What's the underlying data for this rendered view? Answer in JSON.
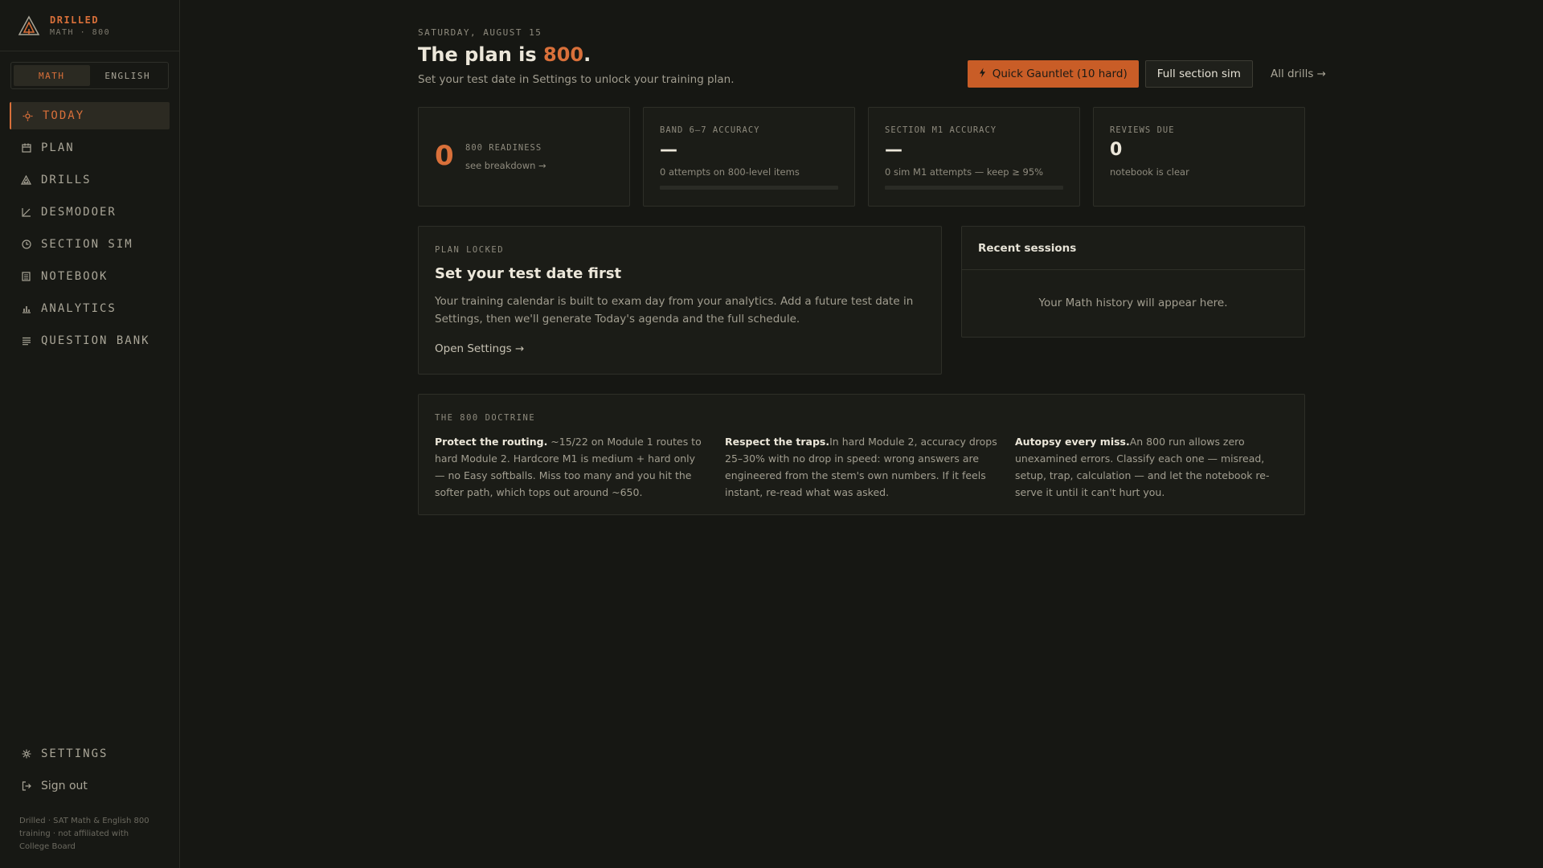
{
  "brand": {
    "name": "DRILLED",
    "sub": "MATH · 800"
  },
  "subject_toggle": {
    "options": [
      "MATH",
      "ENGLISH"
    ],
    "active": "MATH"
  },
  "nav": {
    "items": [
      {
        "label": "TODAY",
        "icon": "sun-icon"
      },
      {
        "label": "PLAN",
        "icon": "calendar-icon"
      },
      {
        "label": "DRILLS",
        "icon": "triangle-icon"
      },
      {
        "label": "DESMODOER",
        "icon": "graph-icon"
      },
      {
        "label": "SECTION SIM",
        "icon": "clock-icon"
      },
      {
        "label": "NOTEBOOK",
        "icon": "notebook-icon"
      },
      {
        "label": "ANALYTICS",
        "icon": "bar-chart-icon"
      },
      {
        "label": "QUESTION BANK",
        "icon": "list-icon"
      }
    ],
    "active": "TODAY",
    "settings": "SETTINGS",
    "signout": "Sign out"
  },
  "footer": "Drilled · SAT Math & English 800 training · not affiliated with College Board",
  "header": {
    "date": "SATURDAY, AUGUST 15",
    "title_prefix": "The plan is ",
    "title_accent": "800",
    "title_suffix": ".",
    "subtitle": "Set your test date in Settings to unlock your training plan."
  },
  "actions": {
    "quick_gauntlet": "Quick Gauntlet (10 hard)",
    "full_sim": "Full section sim",
    "all_drills": "All drills →"
  },
  "stats": {
    "readiness": {
      "value": "0",
      "label": "800 READINESS",
      "link": "see breakdown →"
    },
    "band": {
      "label": "BAND 6–7 ACCURACY",
      "value": "—",
      "sub": "0 attempts on 800-level items",
      "progress": 0
    },
    "m1": {
      "label": "SECTION M1 ACCURACY",
      "value": "—",
      "sub": "0 sim M1 attempts — keep ≥ 95%",
      "progress": 0
    },
    "reviews": {
      "label": "REVIEWS DUE",
      "value": "0",
      "sub": "notebook is clear"
    }
  },
  "plan_locked": {
    "kicker": "PLAN LOCKED",
    "title": "Set your test date first",
    "body": "Your training calendar is built to exam day from your analytics. Add a future test date in Settings, then we'll generate Today's agenda and the full schedule.",
    "link": "Open Settings →"
  },
  "recent": {
    "title": "Recent sessions",
    "empty": "Your Math history will appear here."
  },
  "doctrine": {
    "kicker": "THE 800 DOCTRINE",
    "cols": [
      {
        "bold": "Protect the routing.",
        "text": " ~15/22 on Module 1 routes to hard Module 2. Hardcore M1 is medium + hard only — no Easy softballs. Miss too many and you hit the softer path, which tops out around ~650."
      },
      {
        "bold": "Respect the traps.",
        "text": "In hard Module 2, accuracy drops 25–30% with no drop in speed: wrong answers are engineered from the stem's own numbers. If it feels instant, re-read what was asked."
      },
      {
        "bold": "Autopsy every miss.",
        "text": "An 800 run allows zero unexamined errors. Classify each one — misread, setup, trap, calculation — and let the notebook re-serve it until it can't hurt you."
      }
    ]
  },
  "colors": {
    "accent": "#d9703a",
    "background": "#161713",
    "card": "#1b1c17"
  }
}
